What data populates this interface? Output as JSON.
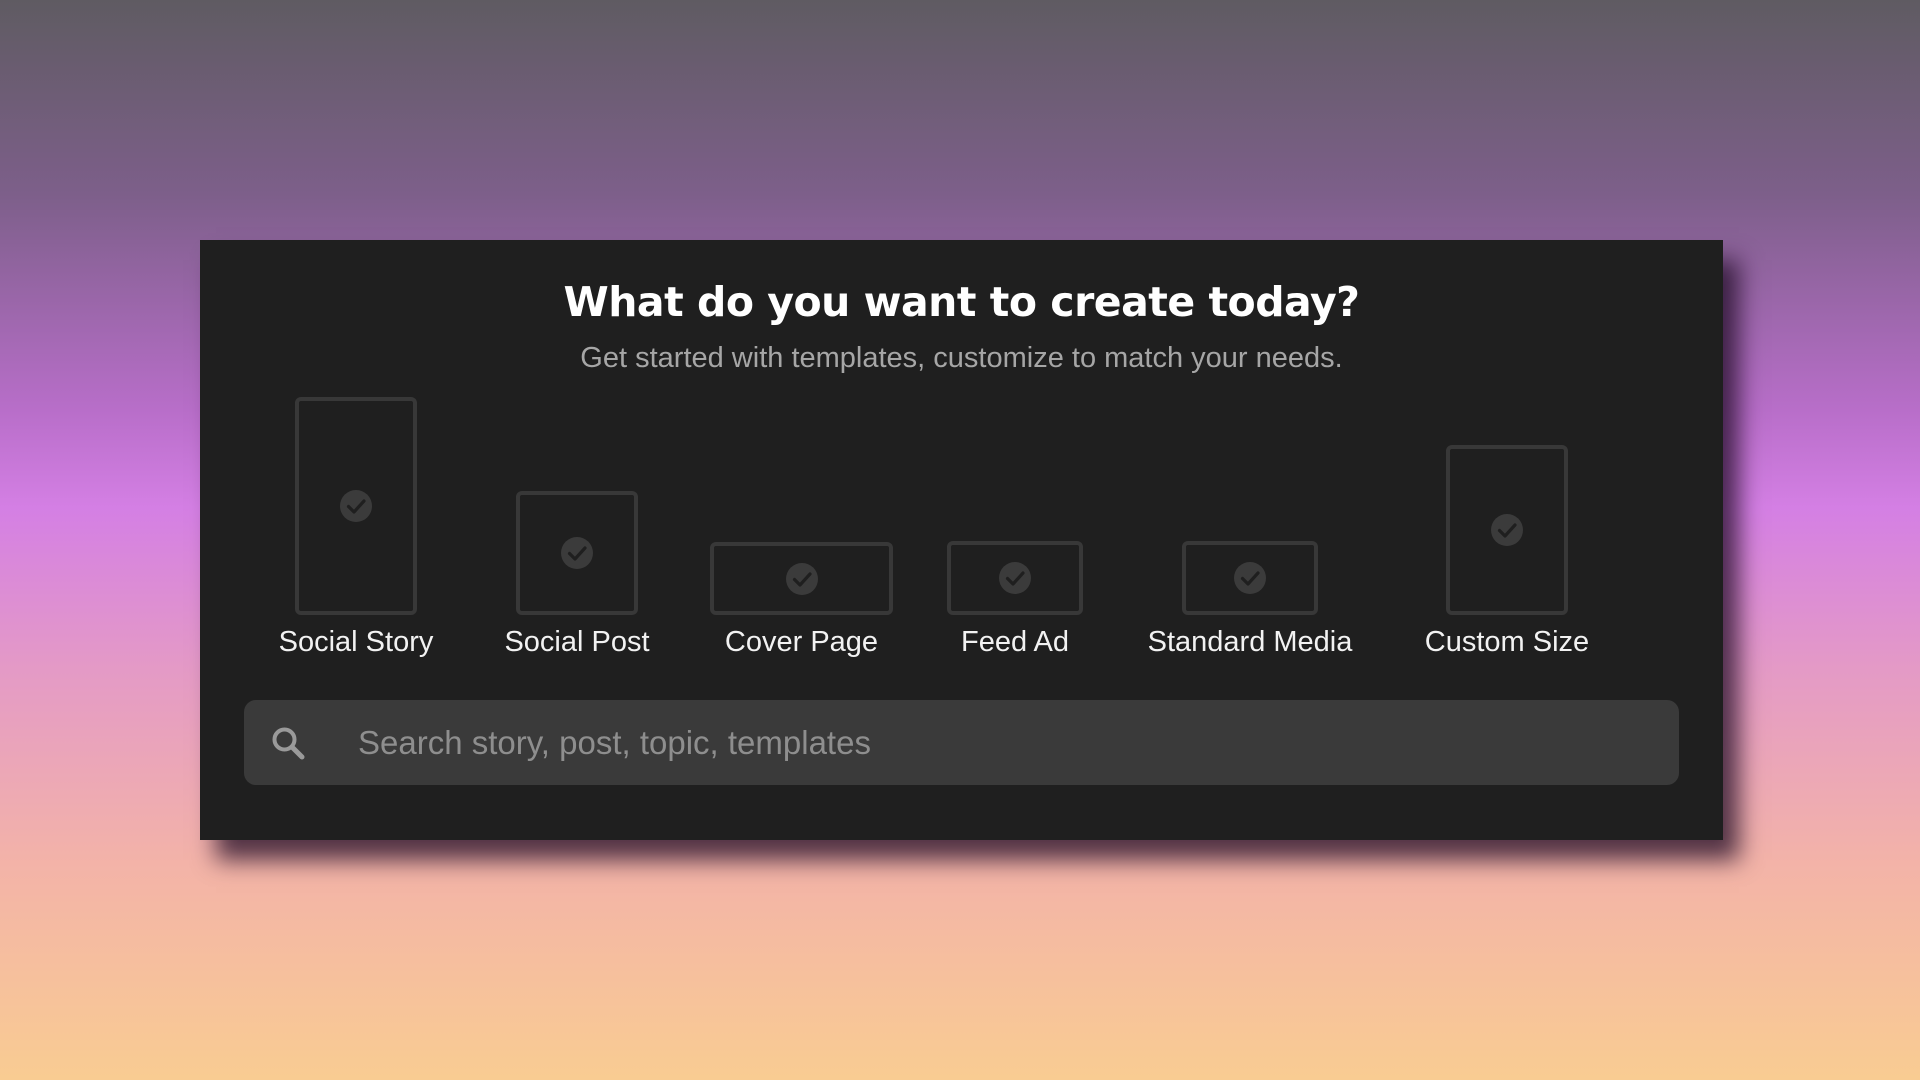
{
  "dialog": {
    "title": "What do you want to create today?",
    "subtitle": "Get started with templates, customize to match your needs."
  },
  "options": [
    {
      "label": "Social Story",
      "icon": "check-circle-icon"
    },
    {
      "label": "Social Post",
      "icon": "check-circle-icon"
    },
    {
      "label": "Cover Page",
      "icon": "check-circle-icon"
    },
    {
      "label": "Feed Ad",
      "icon": "check-circle-icon"
    },
    {
      "label": "Standard Media",
      "icon": "check-circle-icon"
    },
    {
      "label": "Custom Size",
      "icon": "check-circle-icon"
    }
  ],
  "search": {
    "placeholder": "Search story, post, topic, templates",
    "value": "",
    "icon": "search-icon"
  },
  "colors": {
    "panel_background": "#1f1f1f",
    "frame_border": "#383838",
    "search_background": "#3a3a3a",
    "title": "#ffffff",
    "subtitle": "#a6a6a6"
  }
}
